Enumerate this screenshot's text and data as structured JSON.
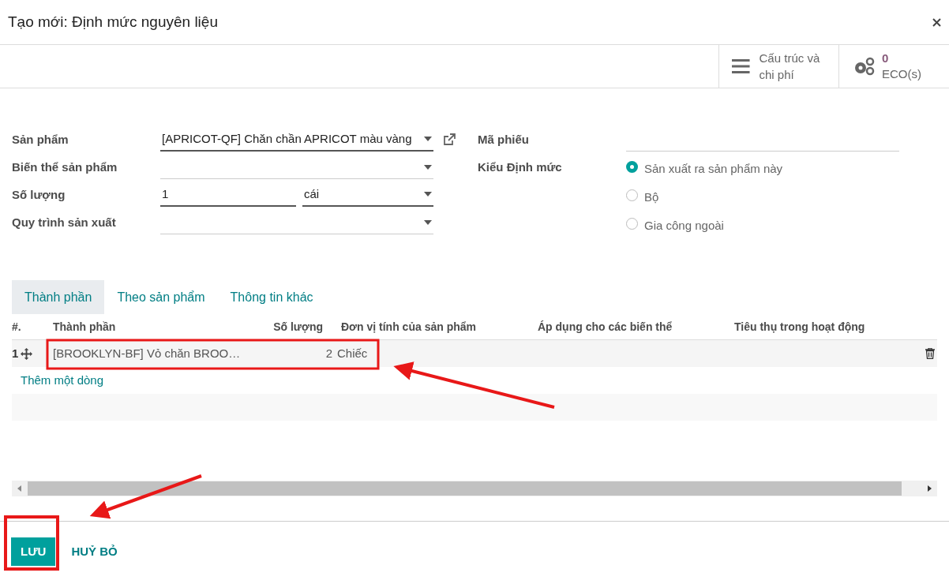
{
  "window": {
    "title": "Tạo mới: Định mức nguyên liệu"
  },
  "toolbar": [
    {
      "kind": "menu",
      "label": "Cấu trúc và chi phí"
    },
    {
      "kind": "gears",
      "count": "0",
      "label": "ECO(s)"
    }
  ],
  "form_left": [
    {
      "label": "Sản phẩm",
      "value": "[APRICOT-QF] Chăn chần APRICOT màu vàng",
      "kind": "select_link"
    },
    {
      "label": "Biến thể sản phẩm",
      "kind": "select"
    },
    {
      "label": "Số lượng",
      "value": "1",
      "unit": "cái",
      "kind": "quantity"
    },
    {
      "label": "Quy trình sản xuất",
      "kind": "select"
    }
  ],
  "form_right": {
    "code_label": "Mã phiếu",
    "type_label": "Kiểu Định mức",
    "options": [
      {
        "label": "Sản xuất ra sản phẩm này",
        "selected": true
      },
      {
        "label": "Bộ",
        "selected": false
      },
      {
        "label": "Gia công ngoài",
        "selected": false
      }
    ]
  },
  "tabs": [
    {
      "label": "Thành phần",
      "selected": true
    },
    {
      "label": "Theo sản phẩm",
      "selected": false
    },
    {
      "label": "Thông tin khác",
      "selected": false
    }
  ],
  "table": {
    "columns": [
      "#.",
      "Thành phần",
      "Số lượng",
      "Đơn vị tính của sản phẩm",
      "Áp dụng cho các biến thể",
      "Tiêu thụ trong hoạt động"
    ],
    "rows": [
      {
        "index": "1",
        "component": "[BROOKLYN-BF] Vỏ chăn BROO…",
        "quantity": "2",
        "uom": "Chiếc"
      }
    ],
    "add_line": "Thêm một dòng"
  },
  "footer": {
    "save": "LƯU",
    "cancel": "HUỶ BỎ"
  }
}
